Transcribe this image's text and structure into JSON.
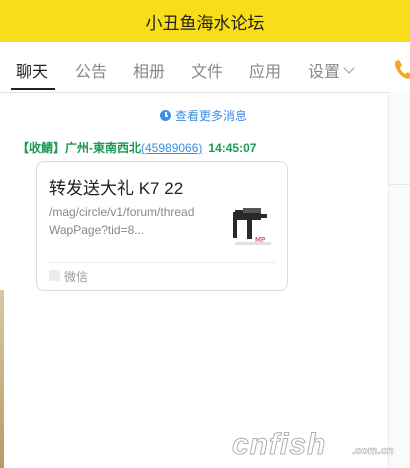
{
  "window": {
    "title": "小丑鱼海水论坛"
  },
  "tabs": [
    {
      "label": "聊天",
      "active": true
    },
    {
      "label": "公告"
    },
    {
      "label": "相册"
    },
    {
      "label": "文件"
    },
    {
      "label": "应用"
    },
    {
      "label": "设置"
    }
  ],
  "chat": {
    "more_link": "查看更多消息",
    "message": {
      "sender_name": "【收鯖】广州-東南西北",
      "sender_id": "(45989066)",
      "time": "14:45:07",
      "card": {
        "title": "转发送大礼 K7 22",
        "url": "/mag/circle/v1/forum/threadWapPage?tid=8...",
        "source": "微信"
      }
    }
  },
  "watermark": {
    "text": "cnfish",
    "sub": ".com.cn"
  },
  "colors": {
    "titlebar": "#f7dd1a",
    "sender": "#1b9a53",
    "link": "#3a8ee6",
    "phone": "#f5a623"
  }
}
